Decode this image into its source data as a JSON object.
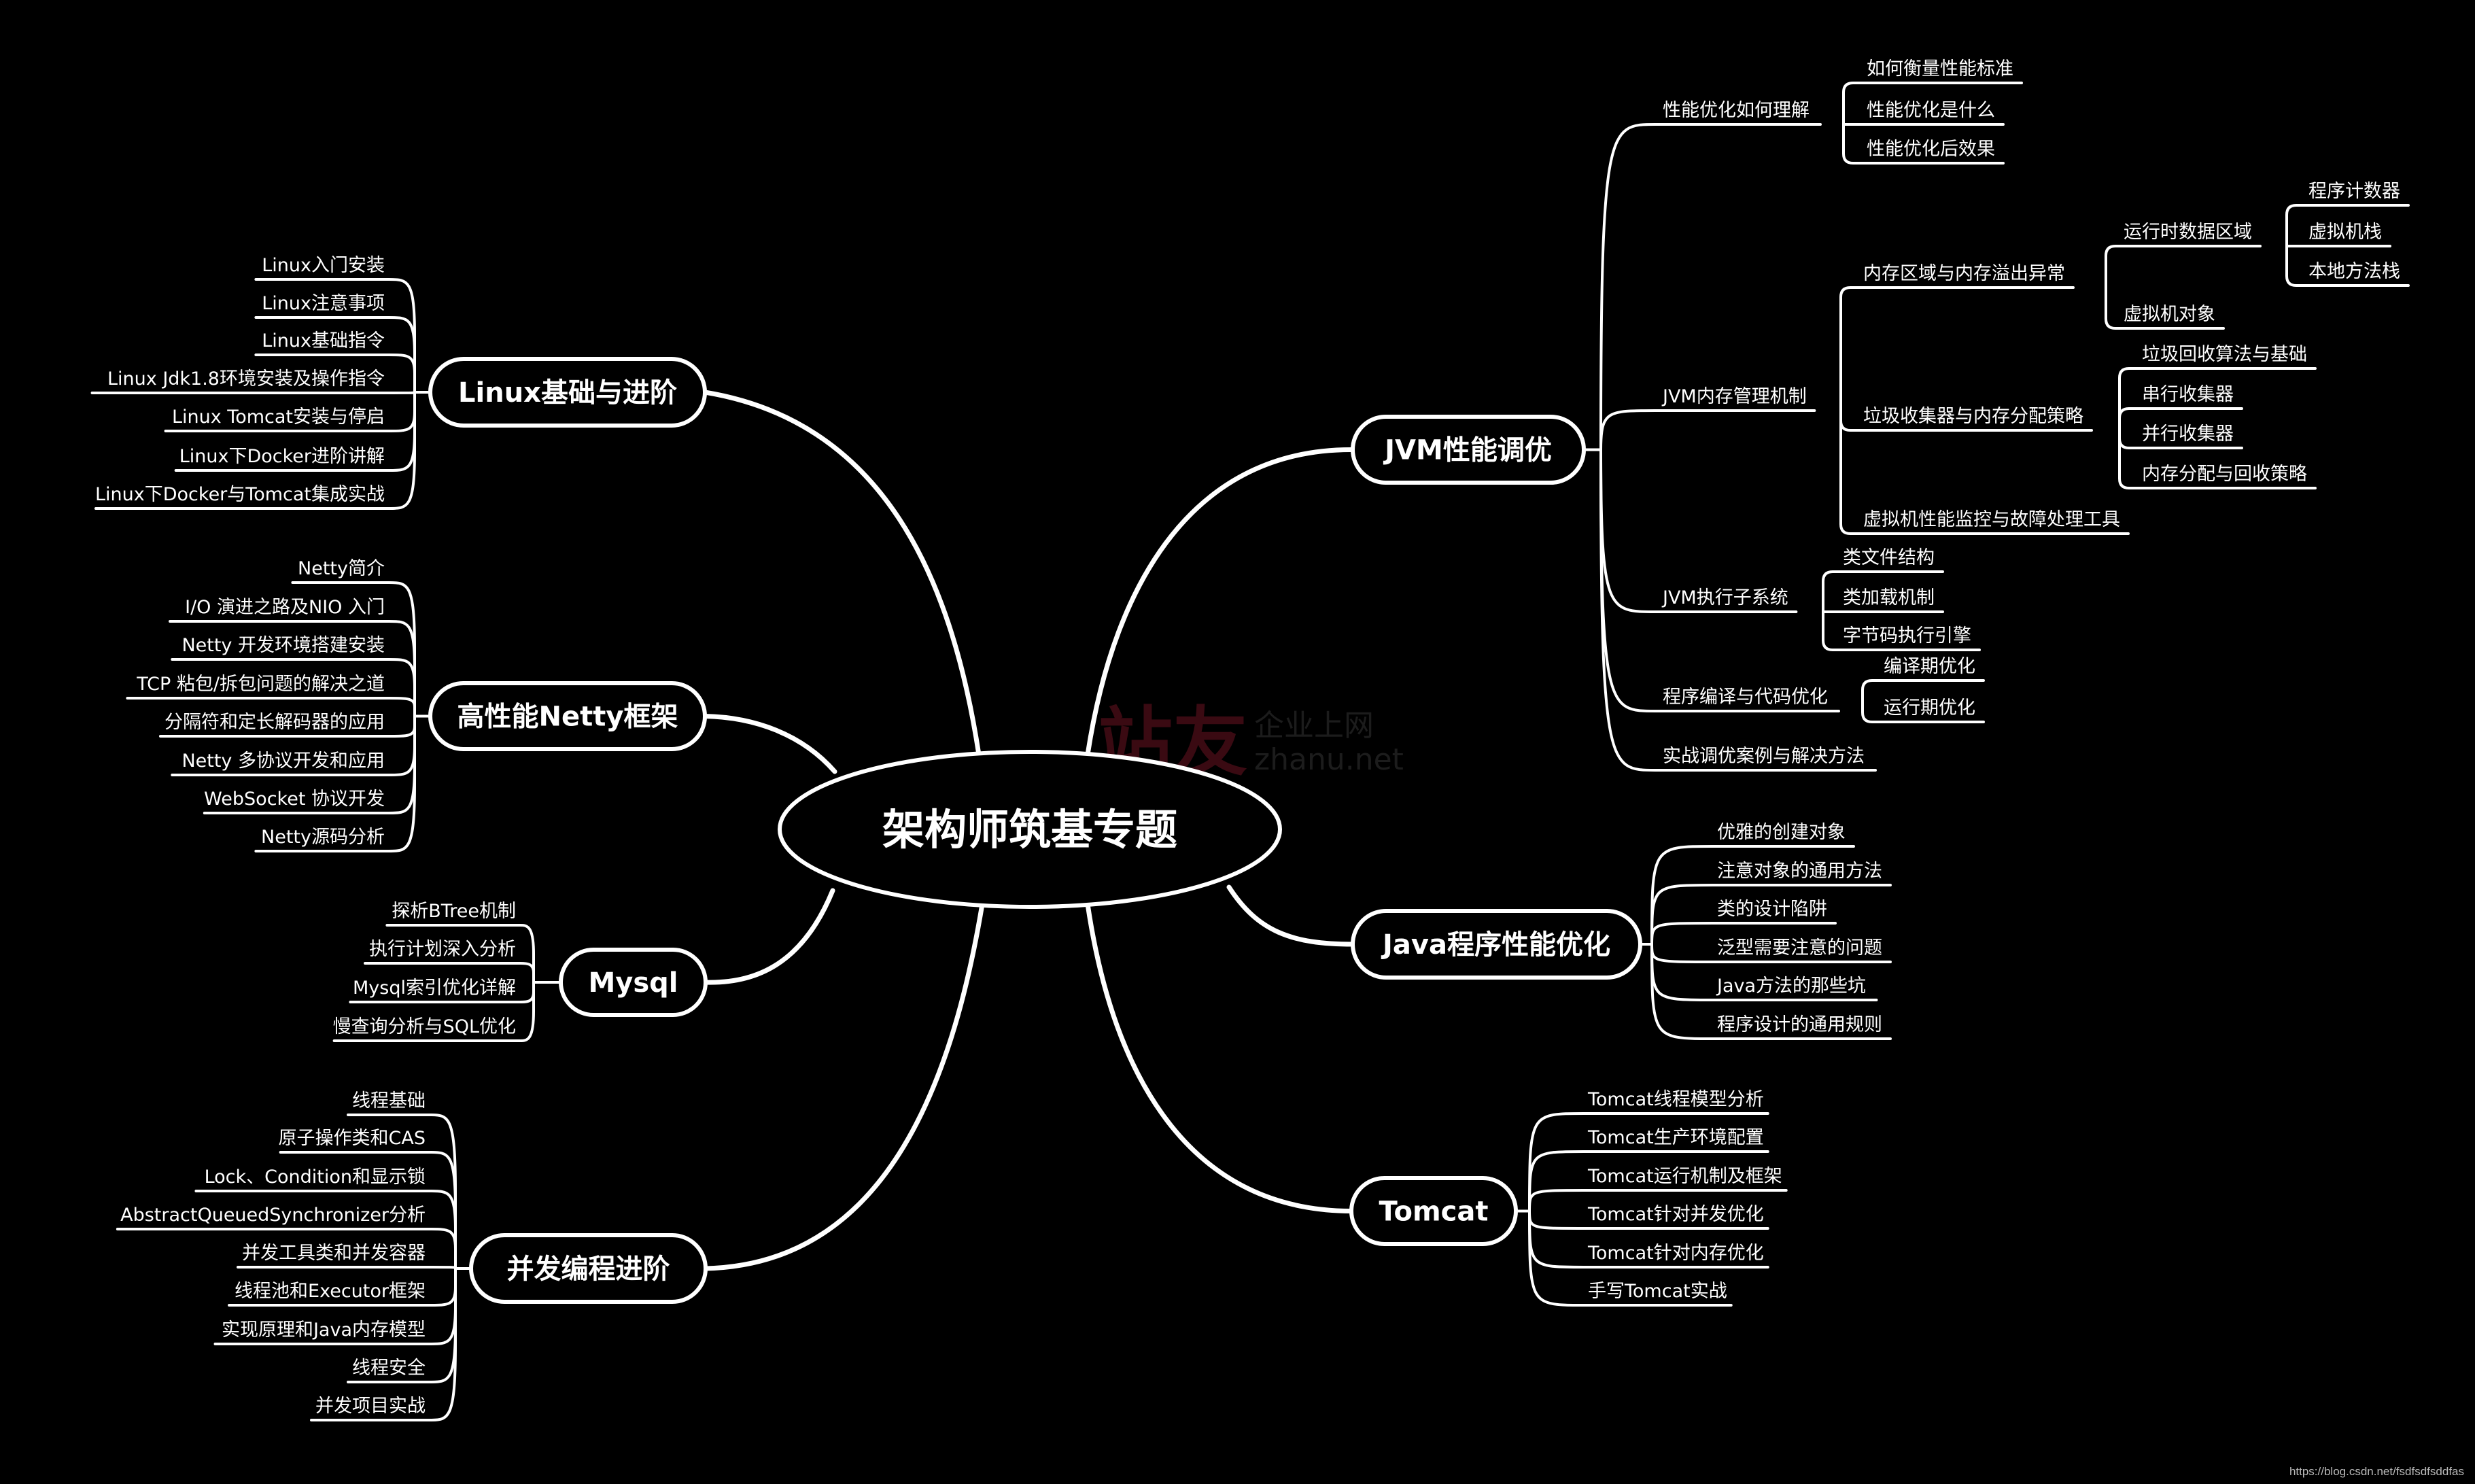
{
  "root": {
    "title": "架构师筑基专题"
  },
  "watermark": {
    "brand": "站友",
    "tagline": "企业上网",
    "domain": "zhanu.net"
  },
  "credit": "https://blog.csdn.net/fsdfsdfsddfas",
  "colors": {
    "background": "#000000",
    "line": "#ffffff",
    "text": "#ffffff",
    "watermark": "#3a0a12"
  },
  "branches": {
    "linux": {
      "title": "Linux基础与进阶",
      "children": [
        {
          "label": "Linux入门安装"
        },
        {
          "label": "Linux注意事项"
        },
        {
          "label": "Linux基础指令"
        },
        {
          "label": "Linux Jdk1.8环境安装及操作指令"
        },
        {
          "label": "Linux Tomcat安装与停启"
        },
        {
          "label": "Linux下Docker进阶讲解"
        },
        {
          "label": "Linux下Docker与Tomcat集成实战"
        }
      ]
    },
    "netty": {
      "title": "高性能Netty框架",
      "children": [
        {
          "label": "Netty简介"
        },
        {
          "label": "I/O 演进之路及NIO 入门"
        },
        {
          "label": "Netty 开发环境搭建安装"
        },
        {
          "label": "TCP 粘包/拆包问题的解决之道"
        },
        {
          "label": "分隔符和定长解码器的应用"
        },
        {
          "label": "Netty 多协议开发和应用"
        },
        {
          "label": "WebSocket 协议开发"
        },
        {
          "label": "Netty源码分析"
        }
      ]
    },
    "mysql": {
      "title": "Mysql",
      "children": [
        {
          "label": "探析BTree机制"
        },
        {
          "label": "执行计划深入分析"
        },
        {
          "label": "Mysql索引优化详解"
        },
        {
          "label": "慢查询分析与SQL优化"
        }
      ]
    },
    "concurrency": {
      "title": "并发编程进阶",
      "children": [
        {
          "label": "线程基础"
        },
        {
          "label": "原子操作类和CAS"
        },
        {
          "label": "Lock、Condition和显示锁"
        },
        {
          "label": "AbstractQueuedSynchronizer分析"
        },
        {
          "label": "并发工具类和并发容器"
        },
        {
          "label": "线程池和Executor框架"
        },
        {
          "label": "实现原理和Java内存模型"
        },
        {
          "label": "线程安全"
        },
        {
          "label": "并发项目实战"
        }
      ]
    },
    "jvm": {
      "title": "JVM性能调优",
      "children": [
        {
          "label": "性能优化如何理解",
          "children": [
            {
              "label": "如何衡量性能标准"
            },
            {
              "label": "性能优化是什么"
            },
            {
              "label": "性能优化后效果"
            }
          ]
        },
        {
          "label": "JVM内存管理机制",
          "children": [
            {
              "label": "内存区域与内存溢出异常",
              "children": [
                {
                  "label": "运行时数据区域",
                  "children": [
                    {
                      "label": "程序计数器"
                    },
                    {
                      "label": "虚拟机栈"
                    },
                    {
                      "label": "本地方法栈"
                    }
                  ]
                },
                {
                  "label": "虚拟机对象"
                }
              ]
            },
            {
              "label": "垃圾收集器与内存分配策略",
              "children": [
                {
                  "label": "垃圾回收算法与基础"
                },
                {
                  "label": "串行收集器"
                },
                {
                  "label": "并行收集器"
                },
                {
                  "label": "内存分配与回收策略"
                }
              ]
            },
            {
              "label": "虚拟机性能监控与故障处理工具"
            }
          ]
        },
        {
          "label": "JVM执行子系统",
          "children": [
            {
              "label": "类文件结构"
            },
            {
              "label": "类加载机制"
            },
            {
              "label": "字节码执行引擎"
            }
          ]
        },
        {
          "label": "程序编译与代码优化",
          "children": [
            {
              "label": "编译期优化"
            },
            {
              "label": "运行期优化"
            }
          ]
        },
        {
          "label": "实战调优案例与解决方法"
        }
      ]
    },
    "java": {
      "title": "Java程序性能优化",
      "children": [
        {
          "label": "优雅的创建对象"
        },
        {
          "label": "注意对象的通用方法"
        },
        {
          "label": "类的设计陷阱"
        },
        {
          "label": "泛型需要注意的问题"
        },
        {
          "label": "Java方法的那些坑"
        },
        {
          "label": "程序设计的通用规则"
        }
      ]
    },
    "tomcat": {
      "title": "Tomcat",
      "children": [
        {
          "label": "Tomcat线程模型分析"
        },
        {
          "label": "Tomcat生产环境配置"
        },
        {
          "label": "Tomcat运行机制及框架"
        },
        {
          "label": "Tomcat针对并发优化"
        },
        {
          "label": "Tomcat针对内存优化"
        },
        {
          "label": "手写Tomcat实战"
        }
      ]
    }
  }
}
